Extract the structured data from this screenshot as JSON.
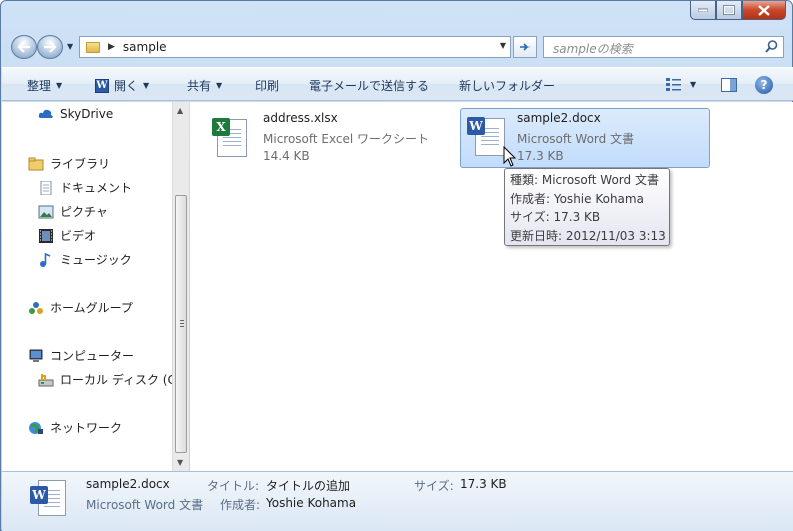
{
  "window": {
    "caption_buttons": [
      "minimize-icon",
      "maximize-icon",
      "close-icon"
    ]
  },
  "address_bar": {
    "path": "sample",
    "search_placeholder": "sampleの検索"
  },
  "toolbar": {
    "organize": "整理",
    "open": "開く",
    "share": "共有",
    "print": "印刷",
    "email": "電子メールで送信する",
    "new_folder": "新しいフォルダー"
  },
  "nav": {
    "skydrive": "SkyDrive",
    "libraries": "ライブラリ",
    "documents": "ドキュメント",
    "pictures": "ピクチャ",
    "videos": "ビデオ",
    "music": "ミュージック",
    "homegroup": "ホームグループ",
    "computer": "コンピューター",
    "local_disk": "ローカル ディスク (C",
    "network": "ネットワーク"
  },
  "files": [
    {
      "name": "address.xlsx",
      "type": "Microsoft Excel ワークシート",
      "size": "14.4 KB"
    },
    {
      "name": "sample2.docx",
      "type": "Microsoft Word 文書",
      "size": "17.3 KB"
    }
  ],
  "tooltip": {
    "type": "種類: Microsoft Word 文書",
    "author": "作成者: Yoshie Kohama",
    "size": "サイズ: 17.3 KB",
    "modified": "更新日時: 2012/11/03 3:13"
  },
  "details": {
    "name": "sample2.docx",
    "type": "Microsoft Word 文書",
    "title_label": "タイトル:",
    "title_value": "タイトルの追加",
    "author_label": "作成者:",
    "author_value": "Yoshie Kohama",
    "size_label": "サイズ:",
    "size_value": "17.3 KB"
  },
  "colors": {
    "excel": "#1e7a3c",
    "word": "#2c5aa7",
    "selection": "#c1dcfc"
  }
}
